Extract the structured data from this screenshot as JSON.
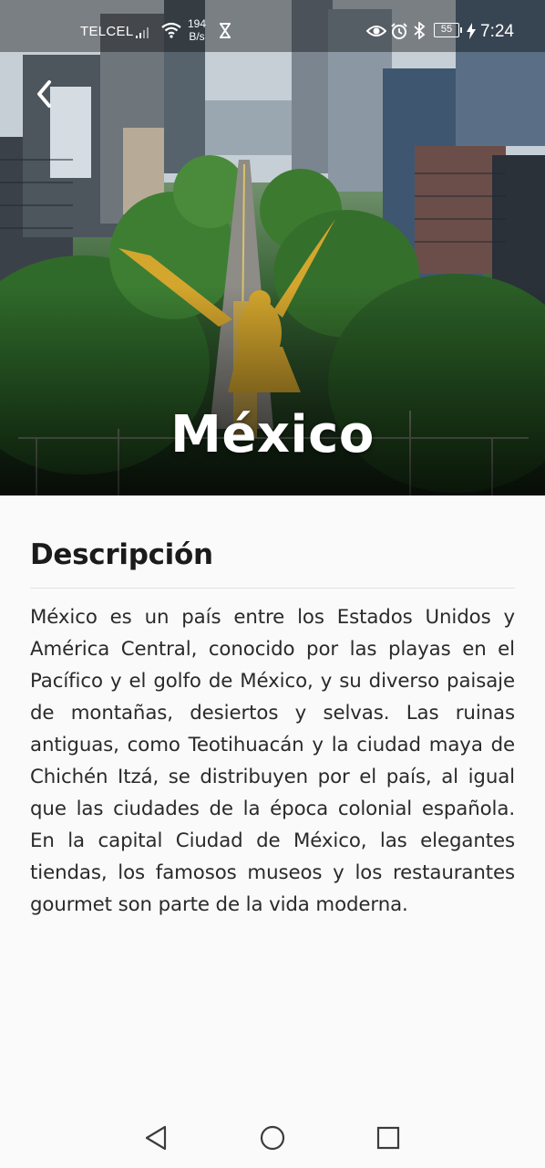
{
  "status_bar": {
    "carrier": "TELCEL",
    "network_speed_value": "194",
    "network_speed_unit": "B/s",
    "battery_level": "55",
    "time": "7:24",
    "icons": [
      "signal-icon",
      "wifi-icon",
      "hourglass-icon",
      "eye-icon",
      "alarm-icon",
      "bluetooth-icon",
      "battery-icon",
      "charging-icon"
    ]
  },
  "hero": {
    "title": "México",
    "back_icon": "chevron-left-icon"
  },
  "description": {
    "heading": "Descripción",
    "body": "México es un país entre los Estados Unidos y América Central, conocido por las playas en el Pacífico y el golfo de México, y su diverso paisaje de montañas, desiertos y selvas. Las ruinas antiguas, como Teotihuacán y la ciudad maya de Chichén Itzá, se distribuyen por el país, al igual que las ciudades de la época colonial española. En la capital Ciudad de México, las elegantes tiendas, los famosos museos y los restaurantes gourmet son parte de la vida moderna."
  },
  "nav_bar": {
    "back_icon": "triangle-back-icon",
    "home_icon": "circle-home-icon",
    "recents_icon": "square-recents-icon"
  },
  "colors": {
    "background": "#fafafa",
    "heading": "#1b1b1b",
    "body_text": "#2a2a2a",
    "hero_title": "#ffffff"
  }
}
